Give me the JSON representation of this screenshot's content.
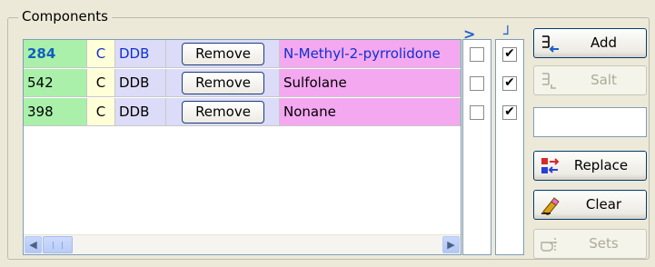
{
  "group": {
    "title": "Components"
  },
  "rows": [
    {
      "id": "284",
      "type": "C",
      "db": "DDB",
      "action": "Remove",
      "name": "N-Methyl-2-pyrrolidone",
      "col1": false,
      "col2": true
    },
    {
      "id": "542",
      "type": "C",
      "db": "DDB",
      "action": "Remove",
      "name": "Sulfolane",
      "col1": false,
      "col2": true
    },
    {
      "id": "398",
      "type": "C",
      "db": "DDB",
      "action": "Remove",
      "name": "Nonane",
      "col1": false,
      "col2": true
    }
  ],
  "columns": {
    "col1_header": ">",
    "col2_header": "┘"
  },
  "buttons": {
    "add": "Add",
    "salt": "Salt",
    "replace": "Replace",
    "clear": "Clear",
    "sets": "Sets"
  },
  "side_input": {
    "value": ""
  },
  "colors": {
    "id_bg": "#aaf0aa",
    "type_bg": "#ffffd8",
    "db_bg": "#dcdcf8",
    "name_bg": "#f4a8f0",
    "accent": "#1f5fd0"
  },
  "icons": {
    "add": "add-arrow-icon",
    "salt": "salt-icon",
    "replace": "replace-arrows-icon",
    "clear": "eraser-icon",
    "sets": "hand-pointer-icon"
  }
}
